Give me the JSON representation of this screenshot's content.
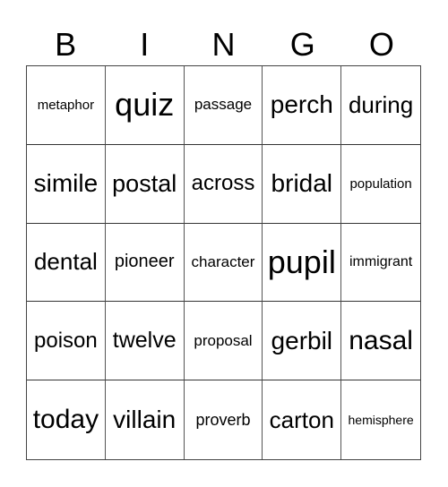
{
  "header": [
    "B",
    "I",
    "N",
    "G",
    "O"
  ],
  "cells": [
    "metaphor",
    "quiz",
    "passage",
    "perch",
    "during",
    "simile",
    "postal",
    "across",
    "bridal",
    "population",
    "dental",
    "pioneer",
    "character",
    "pupil",
    "immigrant",
    "poison",
    "twelve",
    "proposal",
    "gerbil",
    "nasal",
    "today",
    "villain",
    "proverb",
    "carton",
    "hemisphere"
  ]
}
